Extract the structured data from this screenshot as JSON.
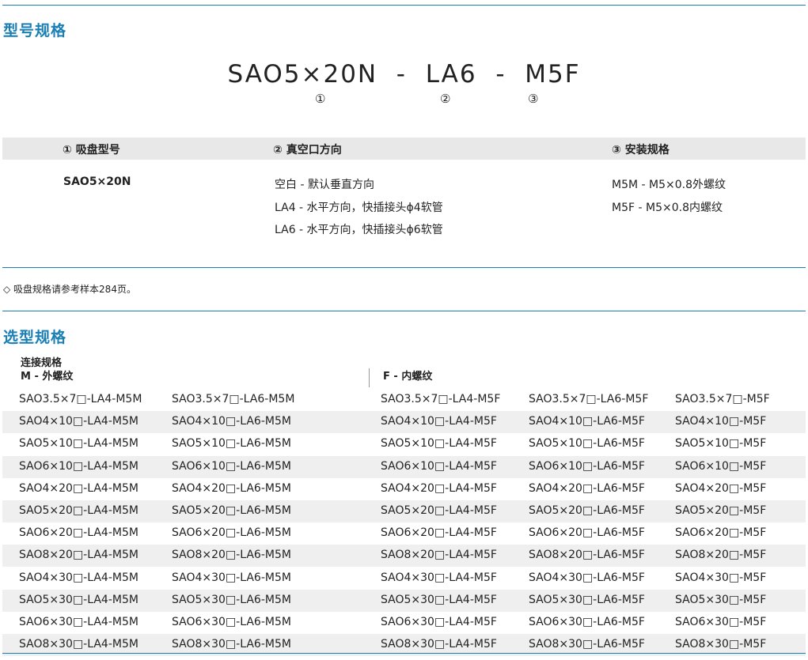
{
  "section1": {
    "title": "型号规格"
  },
  "model": {
    "code": "SAO5×20N  -  LA6  -  M5F",
    "markers": [
      "①",
      "②",
      "③"
    ]
  },
  "spec_table": {
    "headers": [
      "① 吸盘型号",
      "② 真空口方向",
      "③ 安装规格"
    ],
    "col1": [
      "SAO5×20N"
    ],
    "col2": [
      "空白 - 默认垂直方向",
      "LA4  - 水平方向，快插接头ϕ4软管",
      "LA6  - 水平方向，快插接头ϕ6软管"
    ],
    "col3": [
      "M5M - M5×0.8外螺纹",
      "M5F  - M5×0.8内螺纹"
    ]
  },
  "note": "◇ 吸盘规格请参考样本284页。",
  "section2": {
    "title": "选型规格"
  },
  "connection": {
    "label": "连接规格",
    "m_label": "M - 外螺纹",
    "f_label": "F - 内螺纹"
  },
  "selection_rows": [
    [
      "SAO3.5×7□-LA4-M5M",
      "SAO3.5×7□-LA6-M5M",
      "SAO3.5×7□-LA4-M5F",
      "SAO3.5×7□-LA6-M5F",
      "SAO3.5×7□-M5F"
    ],
    [
      "SAO4×10□-LA4-M5M",
      "SAO4×10□-LA6-M5M",
      "SAO4×10□-LA4-M5F",
      "SAO4×10□-LA6-M5F",
      "SAO4×10□-M5F"
    ],
    [
      "SAO5×10□-LA4-M5M",
      "SAO5×10□-LA6-M5M",
      "SAO5×10□-LA4-M5F",
      "SAO5×10□-LA6-M5F",
      "SAO5×10□-M5F"
    ],
    [
      "SAO6×10□-LA4-M5M",
      "SAO6×10□-LA6-M5M",
      "SAO6×10□-LA4-M5F",
      "SAO6×10□-LA6-M5F",
      "SAO6×10□-M5F"
    ],
    [
      "SAO4×20□-LA4-M5M",
      "SAO4×20□-LA6-M5M",
      "SAO4×20□-LA4-M5F",
      "SAO4×20□-LA6-M5F",
      "SAO4×20□-M5F"
    ],
    [
      "SAO5×20□-LA4-M5M",
      "SAO5×20□-LA6-M5M",
      "SAO5×20□-LA4-M5F",
      "SAO5×20□-LA6-M5F",
      "SAO5×20□-M5F"
    ],
    [
      "SAO6×20□-LA4-M5M",
      "SAO6×20□-LA6-M5M",
      "SAO6×20□-LA4-M5F",
      "SAO6×20□-LA6-M5F",
      "SAO6×20□-M5F"
    ],
    [
      "SAO8×20□-LA4-M5M",
      "SAO8×20□-LA6-M5M",
      "SAO8×20□-LA4-M5F",
      "SAO8×20□-LA6-M5F",
      "SAO8×20□-M5F"
    ],
    [
      "SAO4×30□-LA4-M5M",
      "SAO4×30□-LA6-M5M",
      "SAO4×30□-LA4-M5F",
      "SAO4×30□-LA6-M5F",
      "SAO4×30□-M5F"
    ],
    [
      "SAO5×30□-LA4-M5M",
      "SAO5×30□-LA6-M5M",
      "SAO5×30□-LA4-M5F",
      "SAO5×30□-LA6-M5F",
      "SAO5×30□-M5F"
    ],
    [
      "SAO6×30□-LA4-M5M",
      "SAO6×30□-LA6-M5M",
      "SAO6×30□-LA4-M5F",
      "SAO6×30□-LA6-M5F",
      "SAO6×30□-M5F"
    ],
    [
      "SAO8×30□-LA4-M5M",
      "SAO8×30□-LA6-M5M",
      "SAO8×30□-LA4-M5F",
      "SAO8×30□-LA6-M5F",
      "SAO8×30□-M5F"
    ]
  ],
  "colors": {
    "accent": "#1a7fb5",
    "header_bg": "#e8e8e8",
    "row_shade": "#efefef"
  }
}
